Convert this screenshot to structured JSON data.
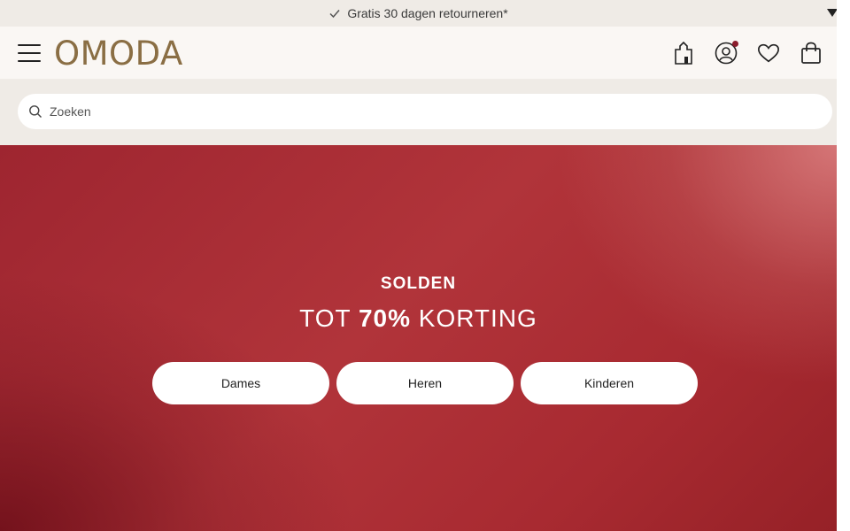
{
  "promo": {
    "text": "Gratis 30 dagen retourneren*"
  },
  "header": {
    "logo": "OMODA"
  },
  "search": {
    "placeholder": "Zoeken"
  },
  "hero": {
    "kicker": "SOLDEN",
    "title_prefix": "TOT",
    "title_highlight": "70%",
    "title_suffix": "KORTING",
    "buttons": [
      "Dames",
      "Heren",
      "Kinderen"
    ]
  },
  "colors": {
    "logo": "#8a6e44",
    "notify_dot": "#8b1d2c",
    "hero_red": "#a82a31",
    "beige": "#efebe6"
  }
}
